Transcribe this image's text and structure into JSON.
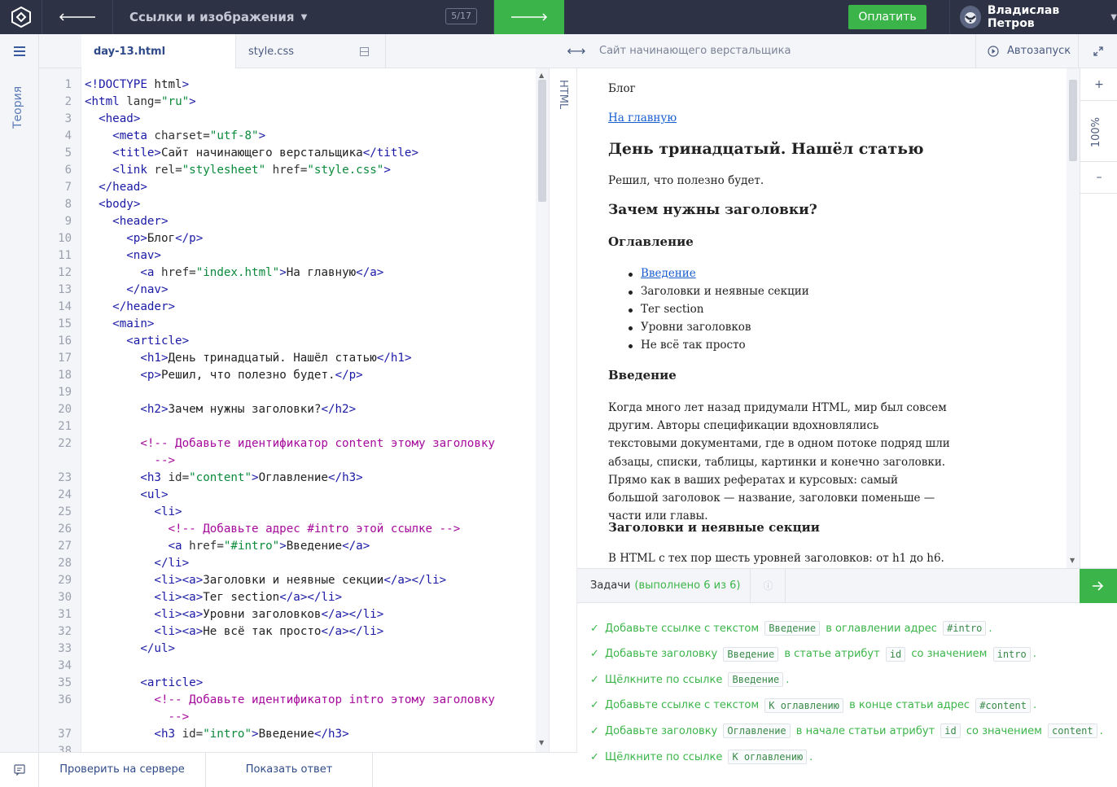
{
  "topbar": {
    "course_title": "Ссылки и изображения",
    "counter": "5/17",
    "pay_label": "Оплатить",
    "user_name": "Владислав Петров"
  },
  "rail": {
    "theory_label": "Теория"
  },
  "tabs": [
    {
      "label": "day-13.html",
      "active": true
    },
    {
      "label": "style.css",
      "active": false
    }
  ],
  "preview": {
    "title": "Сайт начинающего верстальщика",
    "autorun_label": "Автозапуск",
    "zoom": "100%",
    "html_tab": "HTML",
    "blog": "Блог",
    "home_link": "На главную",
    "h1": "День тринадцатый. Нашёл статью",
    "lead": "Решил, что полезно будет.",
    "h2": "Зачем нужны заголовки?",
    "toc_heading": "Оглавление",
    "toc": [
      "Введение",
      "Заголовки и неявные секции",
      "Тег section",
      "Уровни заголовков",
      "Не всё так просто"
    ],
    "intro_heading": "Введение",
    "intro_text": "Когда много лет назад придумали HTML, мир был совсем другим. Авторы спецификации вдохновлялись текстовыми документами, где в одном потоке подряд шли абзацы, списки, таблицы, картинки и конечно заголовки. Прямо как в ваших рефератах и курсовых: самый большой заголовок — название, заголовки поменьше — части или главы.",
    "implicit_heading": "Заголовки и неявные секции",
    "implicit_text": "В HTML с тех пор шесть уровней заголовков: от h1 до h6."
  },
  "code": {
    "lines": [
      {
        "n": "1",
        "t": "<!DOCTYPE html>"
      },
      {
        "n": "2",
        "t": "<html lang=\"ru\">"
      },
      {
        "n": "3",
        "t": "  <head>"
      },
      {
        "n": "4",
        "t": "    <meta charset=\"utf-8\">"
      },
      {
        "n": "5",
        "t": "    <title>Сайт начинающего верстальщика</title>"
      },
      {
        "n": "6",
        "t": "    <link rel=\"stylesheet\" href=\"style.css\">"
      },
      {
        "n": "7",
        "t": "  </head>"
      },
      {
        "n": "8",
        "t": "  <body>"
      },
      {
        "n": "9",
        "t": "    <header>"
      },
      {
        "n": "10",
        "t": "      <p>Блог</p>"
      },
      {
        "n": "11",
        "t": "      <nav>"
      },
      {
        "n": "12",
        "t": "        <a href=\"index.html\">На главную</a>"
      },
      {
        "n": "13",
        "t": "      </nav>"
      },
      {
        "n": "14",
        "t": "    </header>"
      },
      {
        "n": "15",
        "t": "    <main>"
      },
      {
        "n": "16",
        "t": "      <article>"
      },
      {
        "n": "17",
        "t": "        <h1>День тринадцатый. Нашёл статью</h1>"
      },
      {
        "n": "18",
        "t": "        <p>Решил, что полезно будет.</p>"
      },
      {
        "n": "19",
        "t": ""
      },
      {
        "n": "20",
        "t": "        <h2>Зачем нужны заголовки?</h2>"
      },
      {
        "n": "21",
        "t": ""
      },
      {
        "n": "22",
        "t": "        <!-- Добавьте идентификатор content этому заголовку"
      },
      {
        "n": "",
        "t": "          -->"
      },
      {
        "n": "23",
        "t": "        <h3 id=\"content\">Оглавление</h3>"
      },
      {
        "n": "24",
        "t": "        <ul>"
      },
      {
        "n": "25",
        "t": "          <li>"
      },
      {
        "n": "26",
        "t": "            <!-- Добавьте адрес #intro этой ссылке -->"
      },
      {
        "n": "27",
        "t": "            <a href=\"#intro\">Введение</a>"
      },
      {
        "n": "28",
        "t": "          </li>"
      },
      {
        "n": "29",
        "t": "          <li><a>Заголовки и неявные секции</a></li>"
      },
      {
        "n": "30",
        "t": "          <li><a>Тег section</a></li>"
      },
      {
        "n": "31",
        "t": "          <li><a>Уровни заголовков</a></li>"
      },
      {
        "n": "32",
        "t": "          <li><a>Не всё так просто</a></li>"
      },
      {
        "n": "33",
        "t": "        </ul>"
      },
      {
        "n": "34",
        "t": ""
      },
      {
        "n": "35",
        "t": "        <article>"
      },
      {
        "n": "36",
        "t": "          <!-- Добавьте идентификатор intro этому заголовку"
      },
      {
        "n": "",
        "t": "            -->"
      },
      {
        "n": "37",
        "t": "          <h3 id=\"intro\">Введение</h3>"
      },
      {
        "n": "38",
        "t": ""
      }
    ]
  },
  "tasks": {
    "label": "Задачи",
    "status": "(выполнено 6 из 6)",
    "items": [
      [
        {
          "t": "Добавьте ссылке с текстом "
        },
        {
          "c": "Введение"
        },
        {
          "t": " в оглавлении адрес "
        },
        {
          "c": "#intro"
        },
        {
          "t": "."
        }
      ],
      [
        {
          "t": "Добавьте заголовку "
        },
        {
          "c": "Введение"
        },
        {
          "t": " в статье атрибут "
        },
        {
          "c": "id"
        },
        {
          "t": " со значением "
        },
        {
          "c": "intro"
        },
        {
          "t": "."
        }
      ],
      [
        {
          "t": "Щёлкните по ссылке "
        },
        {
          "c": "Введение"
        },
        {
          "t": "."
        }
      ],
      [
        {
          "t": "Добавьте ссылке с текстом "
        },
        {
          "c": "К оглавлению"
        },
        {
          "t": " в конце статьи адрес "
        },
        {
          "c": "#content"
        },
        {
          "t": "."
        }
      ],
      [
        {
          "t": "Добавьте заголовку "
        },
        {
          "c": "Оглавление"
        },
        {
          "t": " в начале статьи атрибут "
        },
        {
          "c": "id"
        },
        {
          "t": " со значением "
        },
        {
          "c": "content"
        },
        {
          "t": "."
        }
      ],
      [
        {
          "t": "Щёлкните по ссылке "
        },
        {
          "c": "К оглавлению"
        },
        {
          "t": "."
        }
      ]
    ]
  },
  "bottom": {
    "check_label": "Проверить на сервере",
    "answer_label": "Показать ответ"
  },
  "colors": {
    "accent_green": "#3bb54a",
    "topbar_bg": "#2d3244",
    "link_blue": "#1a5fd0"
  }
}
